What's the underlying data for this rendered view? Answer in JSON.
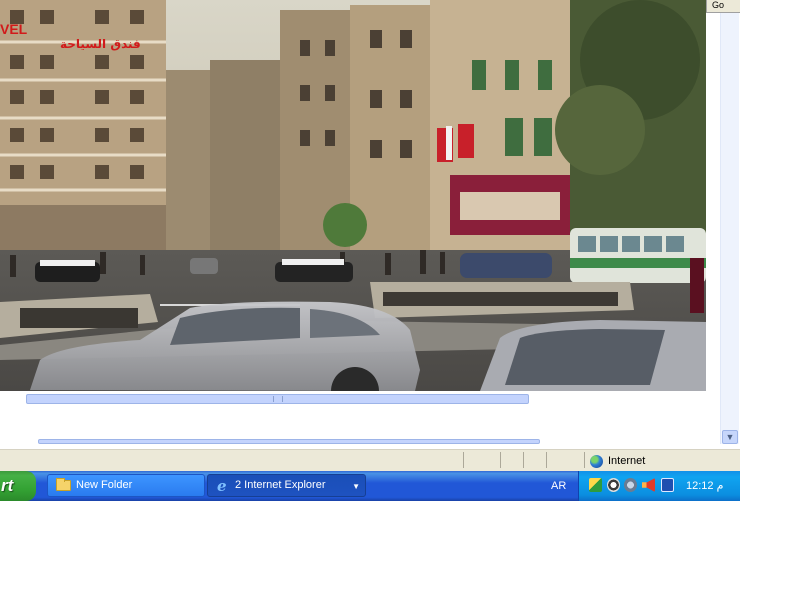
{
  "browser": {
    "go_button_label": "Go",
    "status_bar": {
      "zone_label": "Internet"
    }
  },
  "taskbar": {
    "start_label": "rt",
    "tasks": [
      {
        "label": "New Folder",
        "icon": "folder-icon"
      },
      {
        "label": "2 Internet Explorer",
        "icon": "ie-icon"
      }
    ],
    "language": "AR",
    "clock": "12:12 م",
    "colors": {
      "taskbar": "#2157d7",
      "start": "#34a334",
      "tray": "#10a4f0"
    }
  },
  "photo": {
    "signs": {
      "hotel_vel": "VEL",
      "hotel_arabic": "فندق السياحة"
    }
  }
}
